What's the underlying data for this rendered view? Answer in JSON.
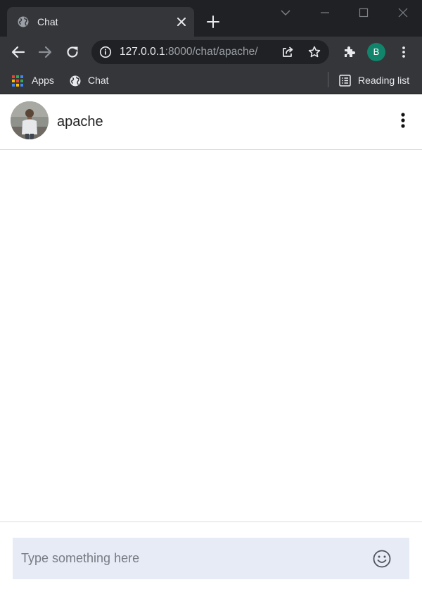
{
  "browser": {
    "tab": {
      "title": "Chat",
      "close": "×"
    },
    "new_tab": "+",
    "address": {
      "host": "127.0.0.1",
      "path": ":8000/chat/apache/"
    },
    "profile_initial": "B",
    "bookmarks": {
      "apps": "Apps",
      "chat": "Chat",
      "reading_list": "Reading list"
    },
    "colors": {
      "frame": "#202124",
      "toolbar": "#35363a",
      "profile": "#11856b"
    }
  },
  "chat": {
    "username": "apache",
    "composer": {
      "placeholder": "Type something here",
      "value": ""
    },
    "colors": {
      "input_bg": "#e7ebf5",
      "divider": "#dcdcdc"
    }
  },
  "icons": {
    "tab": "globe-icon",
    "tab_close": "close-icon",
    "new_tab": "plus-icon",
    "back": "arrow-left-icon",
    "forward": "arrow-right-icon",
    "reload": "reload-icon",
    "info": "info-icon",
    "share": "share-icon",
    "bookmark": "star-icon",
    "extensions": "puzzle-icon",
    "menu": "kebab-menu-icon",
    "apps": "apps-grid-icon",
    "reading_list": "reading-list-icon",
    "options": "vertical-dots-icon",
    "emoji": "smiley-icon"
  }
}
